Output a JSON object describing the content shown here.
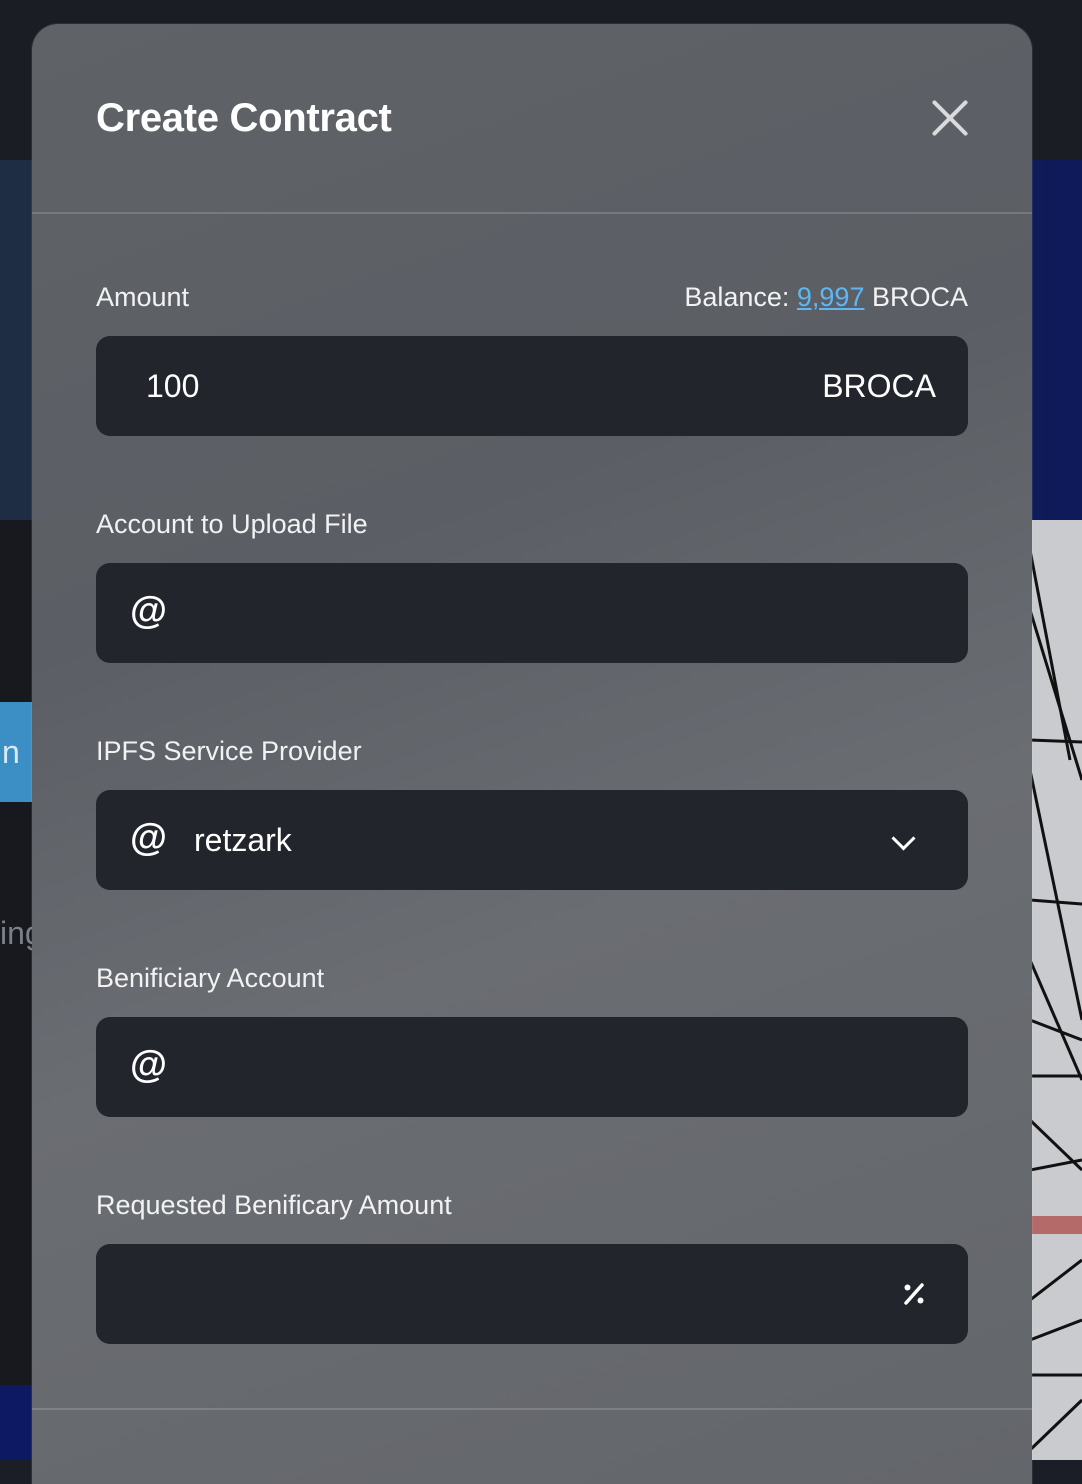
{
  "background": {
    "tab_fragment": "n",
    "text_fragment": "ing"
  },
  "modal": {
    "title": "Create Contract",
    "close_icon": "close-icon"
  },
  "amount": {
    "label": "Amount",
    "balance_label": "Balance: ",
    "balance_value": "9,997",
    "balance_unit": " BROCA",
    "value": "100",
    "unit": "BROCA"
  },
  "upload_account": {
    "label": "Account to Upload File",
    "icon": "@",
    "value": ""
  },
  "ipfs_provider": {
    "label": "IPFS Service Provider",
    "icon": "@",
    "selected": "retzark"
  },
  "beneficiary_account": {
    "label": "Benificiary Account",
    "icon": "@",
    "value": ""
  },
  "beneficiary_amount": {
    "label": "Requested Benificary Amount",
    "value": "",
    "icon": "percent-icon"
  },
  "colors": {
    "field_bg": "#22252b",
    "link": "#5eb6f2",
    "tab_blue": "#3b8fc4"
  }
}
